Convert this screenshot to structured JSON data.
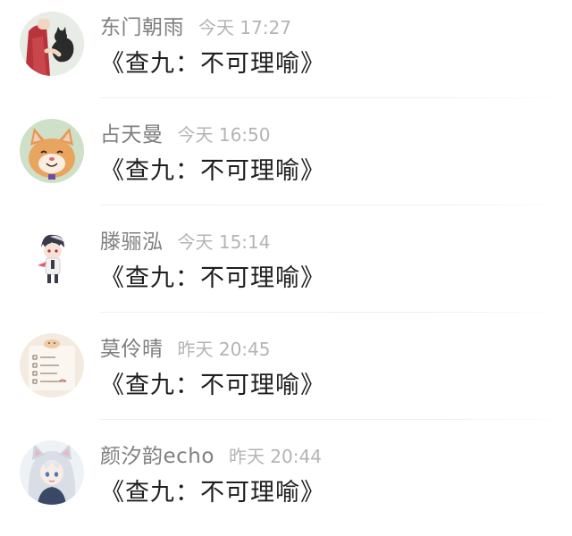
{
  "feed": {
    "items": [
      {
        "user": "东门朝雨",
        "time": "今天 17:27",
        "message": "《查九：不可理喻》",
        "avatar_icon": "girl-with-cat-avatar-icon"
      },
      {
        "user": "占天曼",
        "time": "今天 16:50",
        "message": "《查九：不可理喻》",
        "avatar_icon": "orange-cat-avatar-icon"
      },
      {
        "user": "滕骊泓",
        "time": "今天 15:14",
        "message": "《查九：不可理喻》",
        "avatar_icon": "anime-boy-avatar-icon"
      },
      {
        "user": "莫伶晴",
        "time": "昨天 20:45",
        "message": "《查九：不可理喻》",
        "avatar_icon": "checklist-note-avatar-icon"
      },
      {
        "user": "颜汐韵echo",
        "time": "昨天 20:44",
        "message": "《查九：不可理喻》",
        "avatar_icon": "anime-wolf-girl-avatar-icon"
      }
    ]
  }
}
